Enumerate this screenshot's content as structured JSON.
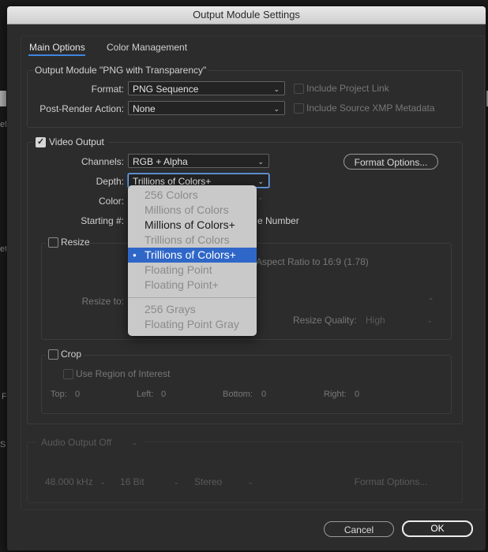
{
  "window": {
    "title": "Output Module Settings"
  },
  "tabs": [
    {
      "label": "Main Options",
      "active": true
    },
    {
      "label": "Color Management",
      "active": false
    }
  ],
  "output_module": {
    "group_title": "Output Module \"PNG with Transparency\"",
    "format_label": "Format:",
    "format_value": "PNG Sequence",
    "post_render_label": "Post-Render Action:",
    "post_render_value": "None",
    "include_project_link": "Include Project Link",
    "include_xmp": "Include Source XMP Metadata"
  },
  "video_output": {
    "checkbox_label": "Video Output",
    "channels_label": "Channels:",
    "channels_value": "RGB + Alpha",
    "depth_label": "Depth:",
    "depth_value": "Trillions of Colors+",
    "color_label": "Color:",
    "starting_label": "Starting #:",
    "starting_suffix": "e Number",
    "format_options": "Format Options...",
    "resize_label": "Resize",
    "resize_to_label": "Resize to:",
    "aspect_text": "Aspect Ratio to 16:9 (1.78)",
    "resize_quality_label": "Resize Quality:",
    "resize_quality_value": "High",
    "crop_label": "Crop",
    "use_roi": "Use Region of Interest",
    "top_label": "Top:",
    "top_value": "0",
    "left_label": "Left:",
    "left_value": "0",
    "bottom_label": "Bottom:",
    "bottom_value": "0",
    "right_label": "Right:",
    "right_value": "0"
  },
  "depth_menu": {
    "items": [
      {
        "label": "256 Colors",
        "state": "disabled"
      },
      {
        "label": "Millions of Colors",
        "state": "disabled"
      },
      {
        "label": "Millions of Colors+",
        "state": "enabled"
      },
      {
        "label": "Trillions of Colors",
        "state": "disabled"
      },
      {
        "label": "Trillions of Colors+",
        "state": "selected"
      },
      {
        "label": "Floating Point",
        "state": "disabled"
      },
      {
        "label": "Floating Point+",
        "state": "disabled"
      },
      {
        "label": "256 Grays",
        "state": "disabled"
      },
      {
        "label": "Floating Point Gray",
        "state": "disabled"
      }
    ]
  },
  "audio": {
    "title": "Audio Output Off",
    "rate": "48.000 kHz",
    "bits": "16 Bit",
    "channels": "Stereo",
    "format_options": "Format Options..."
  },
  "footer": {
    "cancel": "Cancel",
    "ok": "OK"
  },
  "background": {
    "left_1": "ef",
    "left_2": "et",
    "left_3": "F",
    "left_4": "S"
  },
  "colors": {
    "accent": "#2f67c9",
    "focus": "#7aa7e8",
    "dialog_bg": "#2c2c2c"
  }
}
